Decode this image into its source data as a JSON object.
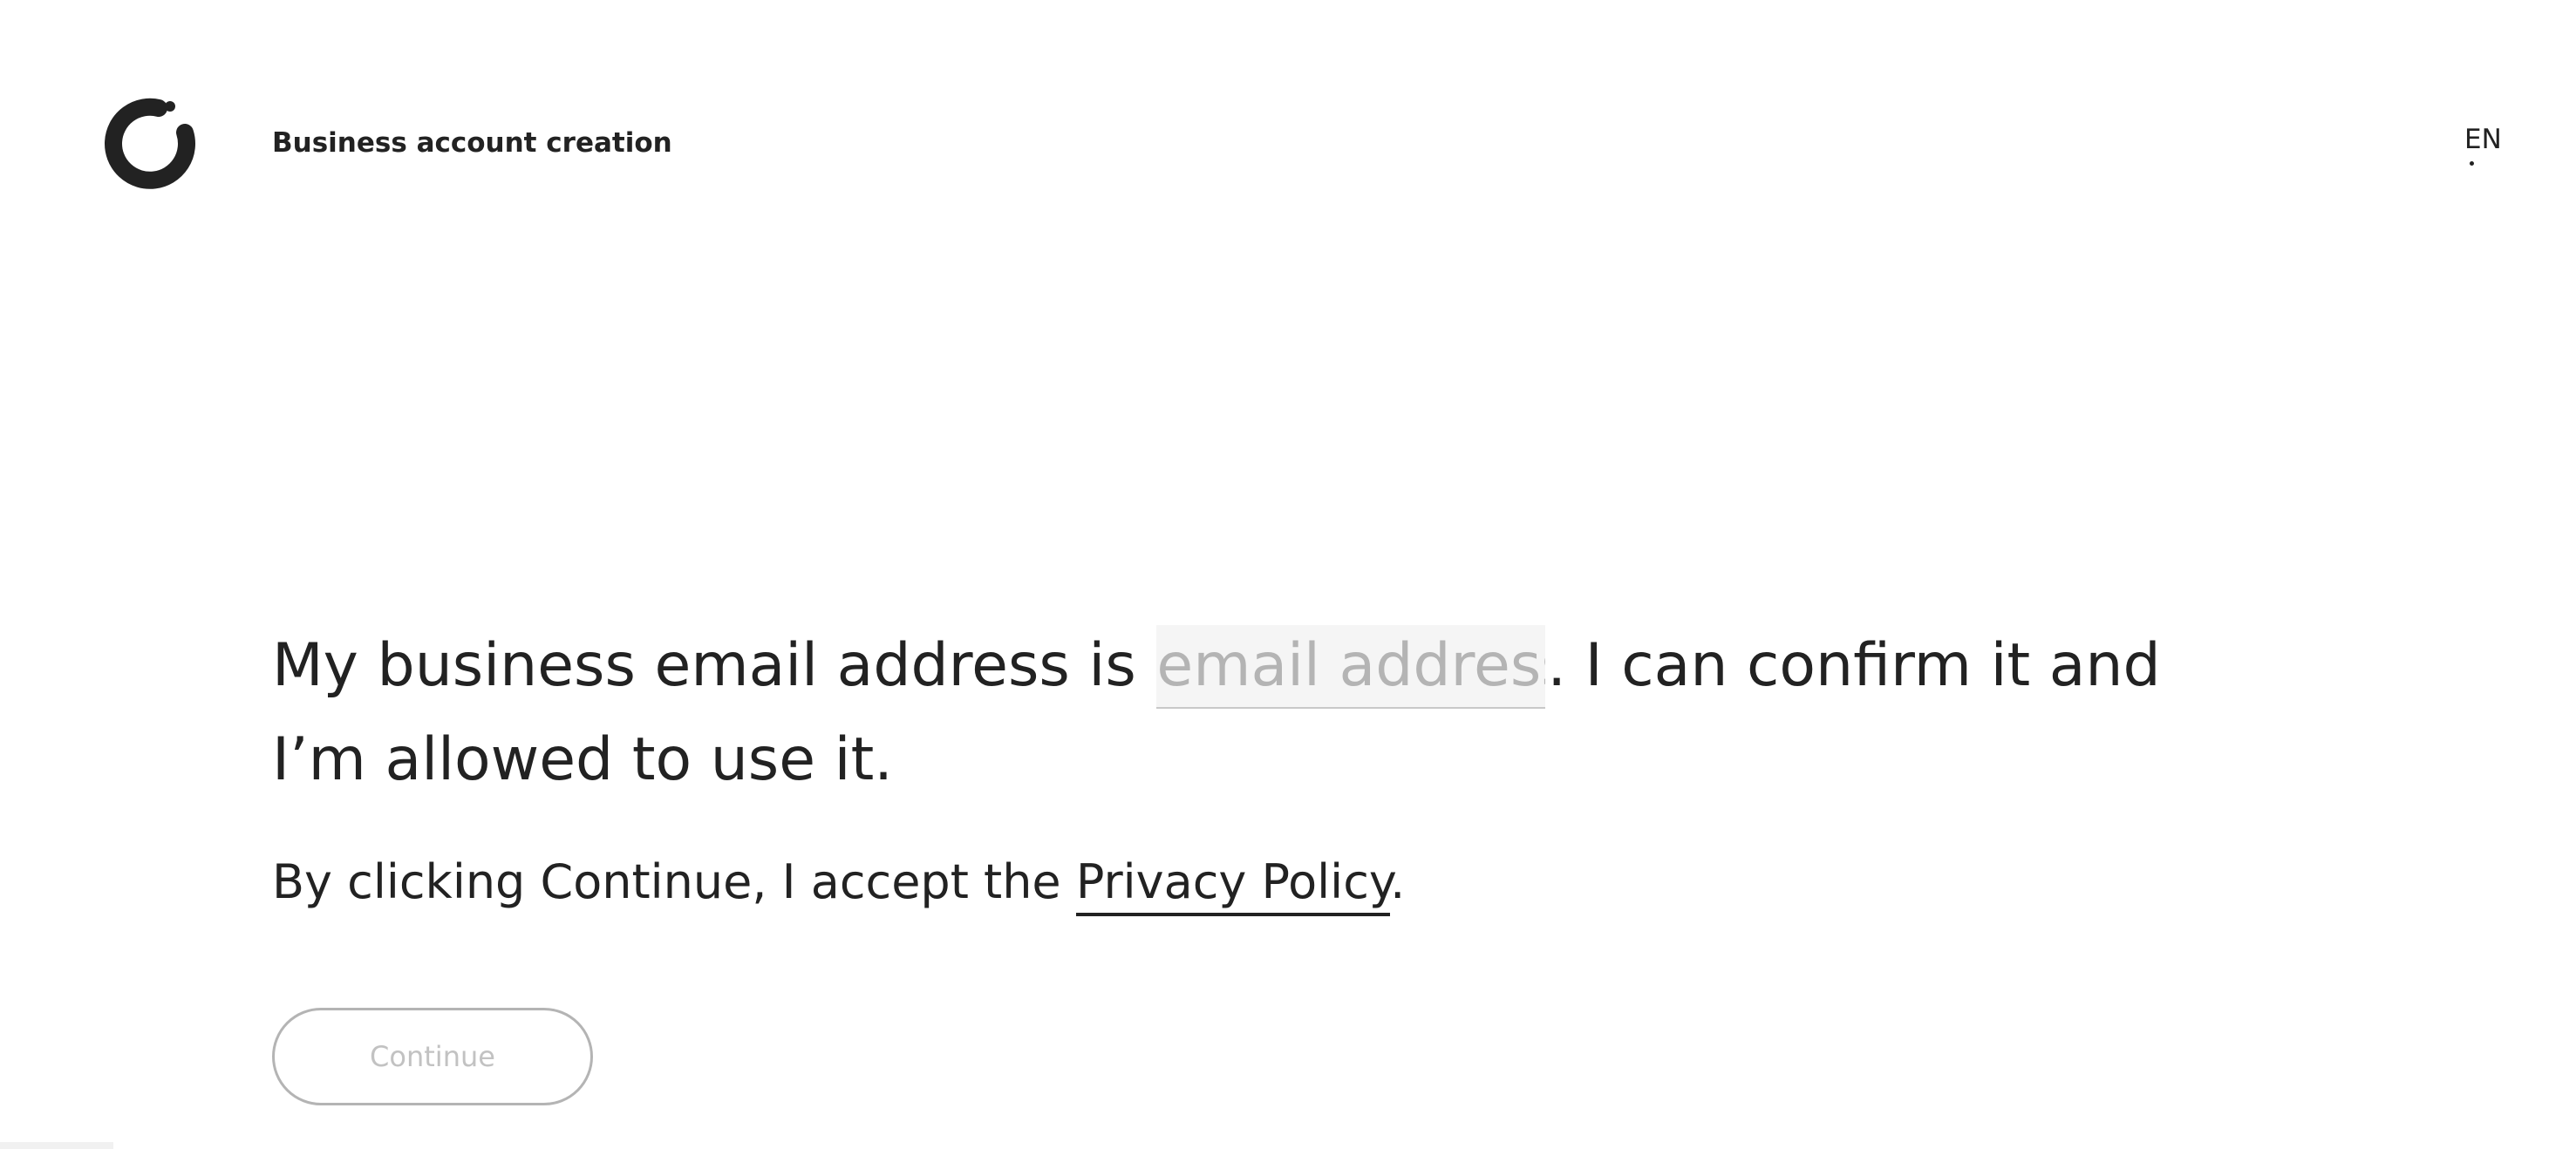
{
  "header": {
    "logo_icon": "brand-ring-logo-icon",
    "title": "Business account creation",
    "language": "EN"
  },
  "form": {
    "statement_prefix": "My business email address is ",
    "email_placeholder": "email address",
    "email_value": "",
    "statement_suffix": ". I can confirm it and I’m allowed to use it.",
    "policy_prefix": "By clicking Continue, I accept the ",
    "policy_link": "Privacy Policy",
    "policy_suffix": ".",
    "continue_label": "Continue",
    "continue_disabled": true
  },
  "colors": {
    "text": "#222222",
    "placeholder": "#b4b4b4",
    "input_background": "#f5f5f5",
    "disabled_border": "#b4b4b4",
    "disabled_text": "#c2c2c2"
  }
}
